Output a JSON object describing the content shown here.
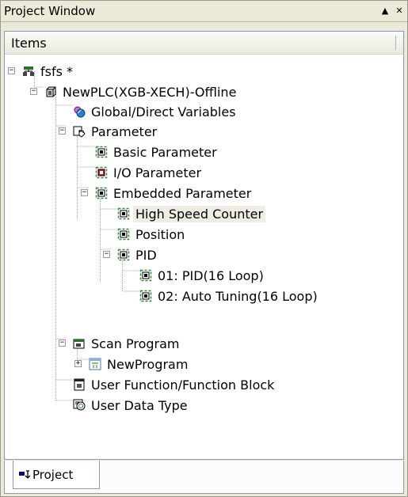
{
  "window": {
    "title": "Project Window",
    "pin_glyph": "▲",
    "close_glyph": "✕"
  },
  "panel": {
    "column_header": "Items"
  },
  "tree": {
    "items": [
      {
        "label": "fsfs *",
        "icon": "project-network-icon",
        "expander": "−"
      },
      {
        "label": "NewPLC(XGB-XECH)-Offline",
        "icon": "plc-cpu-icon",
        "expander": "−"
      },
      {
        "label": "Global/Direct Variables",
        "icon": "global-variables-icon"
      },
      {
        "label": "Parameter",
        "icon": "parameter-folder-icon",
        "expander": "−"
      },
      {
        "label": "Basic Parameter",
        "icon": "basic-parameter-icon"
      },
      {
        "label": "I/O Parameter",
        "icon": "io-parameter-icon"
      },
      {
        "label": "Embedded Parameter",
        "icon": "embedded-parameter-icon",
        "expander": "−"
      },
      {
        "label": "High Speed Counter",
        "icon": "high-speed-counter-icon",
        "selected": true
      },
      {
        "label": "Position",
        "icon": "position-icon"
      },
      {
        "label": "PID",
        "icon": "pid-icon",
        "expander": "−"
      },
      {
        "label": "01: PID(16 Loop)",
        "icon": "pid-loop-icon"
      },
      {
        "label": "02: Auto Tuning(16 Loop)",
        "icon": "auto-tuning-icon"
      },
      {
        "label": "Scan Program",
        "icon": "scan-program-icon",
        "expander": "−"
      },
      {
        "label": "NewProgram",
        "icon": "program-icon",
        "expander": "+"
      },
      {
        "label": "User Function/Function Block",
        "icon": "user-function-icon"
      },
      {
        "label": "User Data Type",
        "icon": "user-data-type-icon"
      }
    ]
  },
  "tabs": {
    "project_label": "Project",
    "project_icon": "project-tab-icon"
  },
  "colors": {
    "window_bg": "#ece9d8",
    "panel_border": "#7f9db9",
    "icon_green": "#2e8b2e",
    "icon_red": "#d02020",
    "selection_bg": "#efece2"
  }
}
